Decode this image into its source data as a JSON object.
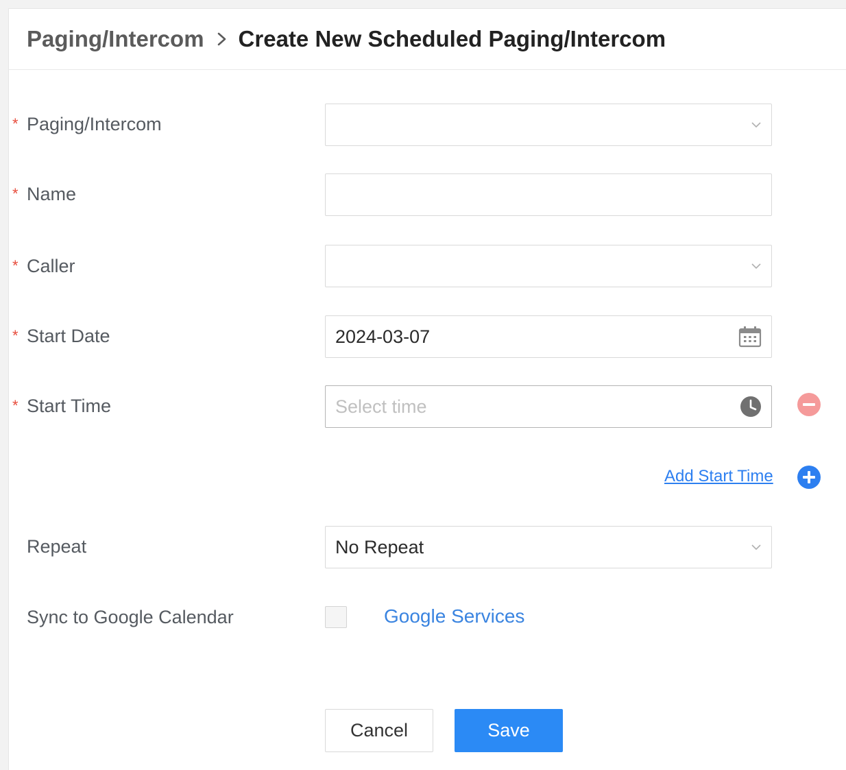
{
  "breadcrumb": {
    "parent": "Paging/Intercom",
    "separator_icon": "chevron-right-icon",
    "current": "Create New Scheduled Paging/Intercom"
  },
  "form": {
    "required_marker": "*",
    "paging_intercom": {
      "label": "Paging/Intercom",
      "value": "",
      "icon": "chevron-down-icon"
    },
    "name": {
      "label": "Name",
      "value": ""
    },
    "caller": {
      "label": "Caller",
      "value": "",
      "icon": "chevron-down-icon"
    },
    "start_date": {
      "label": "Start Date",
      "value": "2024-03-07",
      "icon": "calendar-icon"
    },
    "start_time": {
      "label": "Start Time",
      "placeholder": "Select time",
      "icon": "clock-icon",
      "remove_icon": "minus-circle-icon"
    },
    "add_start_time": {
      "label": "Add Start Time",
      "icon": "plus-circle-icon"
    },
    "repeat": {
      "label": "Repeat",
      "value": "No Repeat",
      "icon": "chevron-down-icon"
    },
    "sync_google": {
      "label": "Sync to Google Calendar",
      "checked": false,
      "link": "Google Services"
    }
  },
  "actions": {
    "cancel": "Cancel",
    "save": "Save"
  },
  "colors": {
    "accent": "#2b8af5",
    "link": "#2d7ff0",
    "required": "#e74c3c",
    "remove": "#f08080"
  }
}
